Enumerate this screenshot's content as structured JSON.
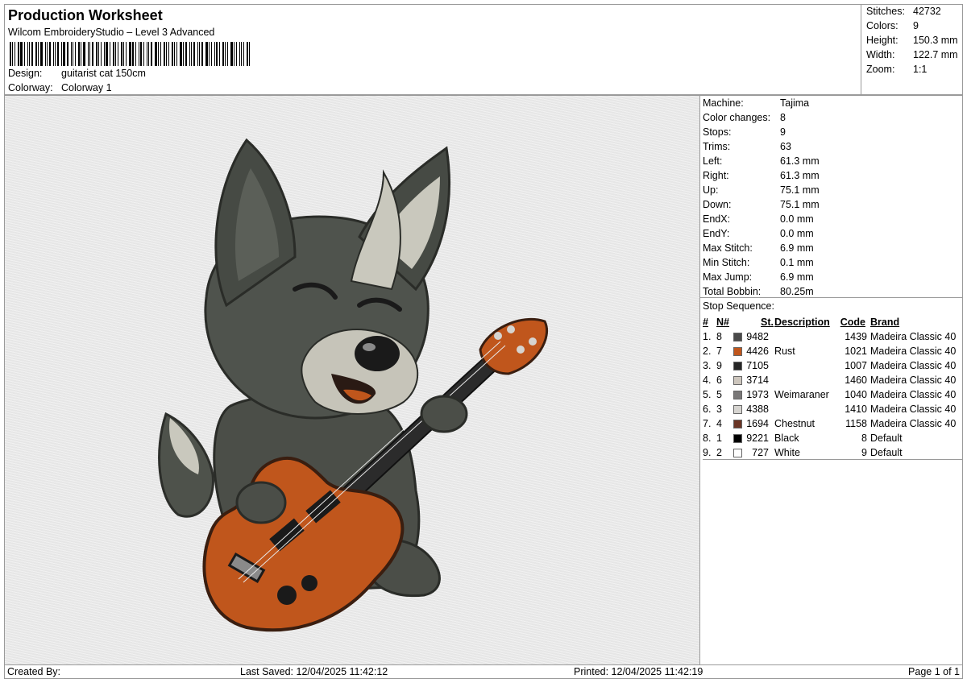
{
  "header": {
    "title": "Production Worksheet",
    "subtitle": "Wilcom EmbroideryStudio – Level 3 Advanced",
    "design_label": "Design:",
    "design_value": "guitarist cat 150cm",
    "colorway_label": "Colorway:",
    "colorway_value": "Colorway 1"
  },
  "stats": {
    "stitches_label": "Stitches:",
    "stitches_value": "42732",
    "colors_label": "Colors:",
    "colors_value": "9",
    "height_label": "Height:",
    "height_value": "150.3 mm",
    "width_label": "Width:",
    "width_value": "122.7 mm",
    "zoom_label": "Zoom:",
    "zoom_value": "1:1"
  },
  "info": [
    {
      "label": "Machine:",
      "value": "Tajima"
    },
    {
      "label": "Color changes:",
      "value": "8"
    },
    {
      "label": "Stops:",
      "value": "9"
    },
    {
      "label": "Trims:",
      "value": "63"
    },
    {
      "label": "Left:",
      "value": "61.3 mm"
    },
    {
      "label": "Right:",
      "value": "61.3 mm"
    },
    {
      "label": "Up:",
      "value": "75.1 mm"
    },
    {
      "label": "Down:",
      "value": "75.1 mm"
    },
    {
      "label": "EndX:",
      "value": "0.0 mm"
    },
    {
      "label": "EndY:",
      "value": "0.0 mm"
    },
    {
      "label": "Max Stitch:",
      "value": "6.9 mm"
    },
    {
      "label": "Min Stitch:",
      "value": "0.1 mm"
    },
    {
      "label": "Max Jump:",
      "value": "6.9 mm"
    },
    {
      "label": "Total Bobbin:",
      "value": "80.25m"
    }
  ],
  "sequence": {
    "title": "Stop Sequence:",
    "headers": {
      "idx": "#",
      "n": "N#",
      "st": "St.",
      "desc": "Description",
      "code": "Code",
      "brand": "Brand"
    },
    "rows": [
      {
        "idx": "1.",
        "n": "8",
        "color": "#4a4a4a",
        "st": "9482",
        "desc": "",
        "code": "1439",
        "brand": "Madeira Classic 40"
      },
      {
        "idx": "2.",
        "n": "7",
        "color": "#c0561c",
        "st": "4426",
        "desc": "Rust",
        "code": "1021",
        "brand": "Madeira Classic 40"
      },
      {
        "idx": "3.",
        "n": "9",
        "color": "#262626",
        "st": "7105",
        "desc": "",
        "code": "1007",
        "brand": "Madeira Classic 40"
      },
      {
        "idx": "4.",
        "n": "6",
        "color": "#cdc6bd",
        "st": "3714",
        "desc": "",
        "code": "1460",
        "brand": "Madeira Classic 40"
      },
      {
        "idx": "5.",
        "n": "5",
        "color": "#7a7878",
        "st": "1973",
        "desc": "Weimaraner",
        "code": "1040",
        "brand": "Madeira Classic 40"
      },
      {
        "idx": "6.",
        "n": "3",
        "color": "#d6d4d0",
        "st": "4388",
        "desc": "",
        "code": "1410",
        "brand": "Madeira Classic 40"
      },
      {
        "idx": "7.",
        "n": "4",
        "color": "#6a3525",
        "st": "1694",
        "desc": "Chestnut",
        "code": "1158",
        "brand": "Madeira Classic 40"
      },
      {
        "idx": "8.",
        "n": "1",
        "color": "#000000",
        "st": "9221",
        "desc": "Black",
        "code": "8",
        "brand": "Default"
      },
      {
        "idx": "9.",
        "n": "2",
        "color": "#ffffff",
        "st": "727",
        "desc": "White",
        "code": "9",
        "brand": "Default"
      }
    ]
  },
  "footer": {
    "created": "Created By:",
    "saved": "Last Saved: 12/04/2025 11:42:12",
    "printed": "Printed: 12/04/2025 11:42:19",
    "page": "Page 1 of 1"
  }
}
